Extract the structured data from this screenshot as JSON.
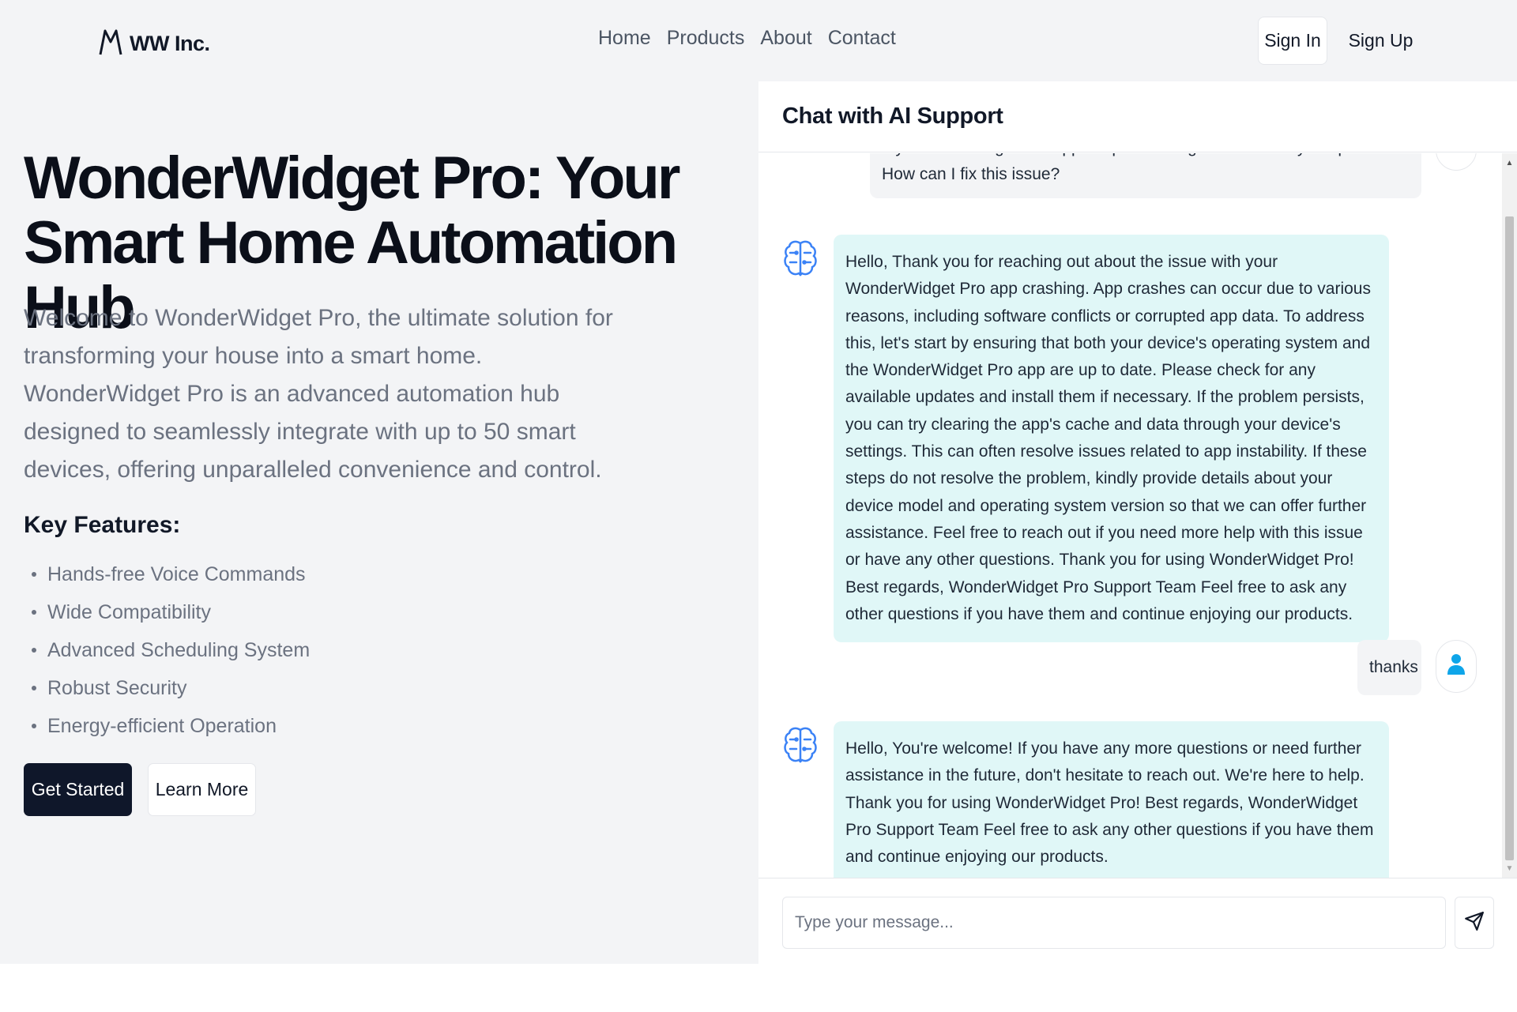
{
  "header": {
    "brand": "WW Inc.",
    "brand_icon": "mountain-logo-icon",
    "nav": [
      "Home",
      "Products",
      "About",
      "Contact"
    ],
    "sign_in": "Sign In",
    "sign_up": "Sign Up"
  },
  "hero": {
    "title": "WonderWidget Pro: Your Smart Home Automation Hub",
    "description": "Welcome to WonderWidget Pro, the ultimate solution for transforming your house into a smart home. WonderWidget Pro is an advanced automation hub designed to seamlessly integrate with up to 50 smart devices, offering unparalleled convenience and control.",
    "features_title": "Key Features:",
    "features": [
      "Hands-free Voice Commands",
      "Wide Compatibility",
      "Advanced Scheduling System",
      "Robust Security",
      "Energy-efficient Operation"
    ],
    "primary_button": "Get Started",
    "secondary_button": "Learn More"
  },
  "chat": {
    "title": "Chat with AI Support",
    "messages": [
      {
        "role": "user",
        "text": "My WonderWidget Pro app keeps crashing whenever I try to open it. How can I fix this issue?"
      },
      {
        "role": "assistant",
        "text": "Hello, Thank you for reaching out about the issue with your WonderWidget Pro app crashing. App crashes can occur due to various reasons, including software conflicts or corrupted app data. To address this, let's start by ensuring that both your device's operating system and the WonderWidget Pro app are up to date. Please check for any available updates and install them if necessary. If the problem persists, you can try clearing the app's cache and data through your device's settings. This can often resolve issues related to app instability. If these steps do not resolve the problem, kindly provide details about your device model and operating system version so that we can offer further assistance. Feel free to reach out if you need more help with this issue or have any other questions. Thank you for using WonderWidget Pro! Best regards, WonderWidget Pro Support Team Feel free to ask any other questions if you have them and continue enjoying our products."
      },
      {
        "role": "user",
        "text": "thanks"
      },
      {
        "role": "assistant",
        "text": "Hello, You're welcome! If you have any more questions or need further assistance in the future, don't hesitate to reach out. We're here to help. Thank you for using WonderWidget Pro! Best regards, WonderWidget Pro Support Team Feel free to ask any other questions if you have them and continue enjoying our products."
      }
    ],
    "input_placeholder": "Type your message...",
    "input_value": "",
    "send_icon": "send-icon",
    "user_avatar_icon": "user-icon",
    "bot_avatar_icon": "brain-icon"
  },
  "colors": {
    "page_bg": "#f3f4f6",
    "primary_button_bg": "#0f172a",
    "assistant_bubble_bg": "#e0f7f7",
    "user_bubble_bg": "#f3f4f6",
    "user_avatar_accent": "#0ea5e9",
    "bot_avatar_accent": "#3b82f6"
  }
}
